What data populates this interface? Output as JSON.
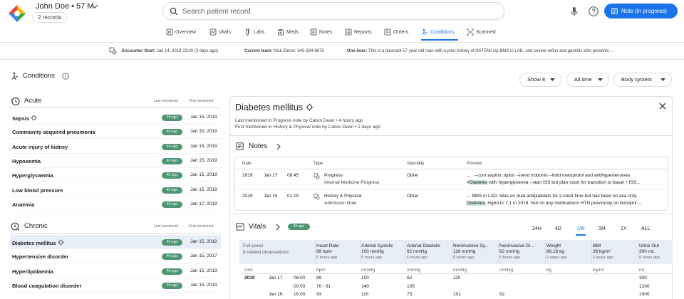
{
  "header": {
    "patient": "John Doe • 57 M",
    "records_chip": "2 records",
    "search_placeholder": "Search patient record",
    "note_button": "Note (in progress)",
    "colors": {
      "accent": "#1a73e8",
      "badge": "#4f9774"
    }
  },
  "tabs": [
    {
      "label": "Overview",
      "icon": "overview-icon"
    },
    {
      "label": "Vitals",
      "icon": "vitals-icon"
    },
    {
      "label": "Labs",
      "icon": "labs-icon"
    },
    {
      "label": "Meds",
      "icon": "meds-icon"
    },
    {
      "label": "Notes",
      "icon": "notes-icon"
    },
    {
      "label": "Reports",
      "icon": "reports-icon"
    },
    {
      "label": "Orders",
      "icon": "orders-icon"
    },
    {
      "label": "Conditions",
      "icon": "conditions-icon",
      "active": true
    },
    {
      "label": "Scanned",
      "icon": "scanned-icon"
    }
  ],
  "encounter": {
    "start_label": "Encounter Start:",
    "start_value": "Jan 14, 2019  23:00 (3 days ago)",
    "team_label": "Current team:",
    "team_value": "Nick Elmos: 645-334-9675",
    "oneliner_label": "One-liner:",
    "oneliner_value": "This is a pleasant 57 year-old man with a prior history of NSTEMI s/p BMS in LAD, and severe reflux and gastritis who presents ..."
  },
  "conditions": {
    "title": "Conditions",
    "filters": [
      "Show 8",
      "All time",
      "Body system"
    ],
    "acute": {
      "title": "Acute",
      "col_last": "Last mentioned",
      "col_first": "First mentioned",
      "items": [
        {
          "name": "Sepsis",
          "badge": "4h ago",
          "date": "Jan 15, 2019"
        },
        {
          "name": "Community acquired pneumonia",
          "badge": "4h ago",
          "date": "Jan 15, 2019"
        },
        {
          "name": "Acute injury of kidney",
          "badge": "4h ago",
          "date": "Jan 15, 2019"
        },
        {
          "name": "Hypoxemia",
          "badge": "4h ago",
          "date": "Jan 15, 2019"
        },
        {
          "name": "Hyperglycaemia",
          "badge": "4h ago",
          "date": "Jan 15, 2019"
        },
        {
          "name": "Low blood pressure",
          "badge": "4h ago",
          "date": "Jan 15, 2019"
        },
        {
          "name": "Anaemia",
          "badge": "4h ago",
          "date": "Jan 17, 2019"
        }
      ]
    },
    "chronic": {
      "title": "Chronic",
      "col_last": "Last mentioned",
      "col_first": "First mentioned",
      "items": [
        {
          "name": "Diabetes mellitus",
          "badge": "4h ago",
          "date": "Jan 15, 2019"
        },
        {
          "name": "Hypertensive disorder",
          "badge": "4h ago",
          "date": "Jan 15, 2017"
        },
        {
          "name": "Hyperlipidaemia",
          "badge": "4h ago",
          "date": "Jan 15, 2019"
        },
        {
          "name": "Blood coagulation disorder",
          "badge": "4h ago",
          "date": "Jan 15, 2019"
        }
      ]
    }
  },
  "detail": {
    "title": "Diabetes mellitus",
    "last_mentioned": "Last mentioned in Progress note by Calvin Dean • 4 hours ago",
    "first_mentioned": "First mentioned in History & Physical note by Calvin Dean • 2 days ago",
    "notes": {
      "title": "Notes",
      "columns": [
        "Date",
        "Type",
        "Specialty",
        "Preview"
      ],
      "rows": [
        {
          "year": "2019",
          "day": "Jan 17",
          "time": "08:45",
          "type": "Progress",
          "subtype": "Internal Medicine Progress",
          "specialty": "Other",
          "preview1": "... . --cont aspirin, lipitor --trend troponin --hold metoprolol and antihypertensives",
          "preview2_pre": "#",
          "preview2_hl": "Diabetes",
          "preview2_post": " with hyperglycemia --start ISS but plan soon for transition to basal + ISS..."
        },
        {
          "year": "2019",
          "day": "Jan 15",
          "time": "01:15",
          "type": "History & Physical",
          "subtype": "Admission Note",
          "specialty": "Other",
          "preview1": "... BMS in LAD. Was on dual antiplatelets for a short time but has been on asa only.",
          "preview2_pre": "",
          "preview2_hl": "Diabetes",
          "preview2_post": ", HgbA1c 7.1 in 2018. Not on any medications HTN previously on lisinopril ..."
        }
      ]
    },
    "vitals": {
      "title": "Vitals",
      "badge": "4h ago",
      "ranges": [
        "24H",
        "4D",
        "1W",
        "1M",
        "1Y",
        "ALL"
      ],
      "active_range": "1W",
      "full_panel": "Full panel",
      "related": "8 related observations",
      "unit_label": "Unit",
      "columns": [
        {
          "name": "Heart Rate",
          "value": "89 bpm",
          "ago": "5 hours ago",
          "unit": "bpm"
        },
        {
          "name": "Arterial Systolic",
          "value": "100 mmHg",
          "ago": "5 hours ago",
          "unit": "mmHg"
        },
        {
          "name": "Arterial Diastolic",
          "value": "62 mmHg",
          "ago": "5 hours ago",
          "unit": "mmHg"
        },
        {
          "name": "Noninvasive Sy...",
          "value": "110 mmHg",
          "ago": "5 hours ago",
          "unit": "mmHg"
        },
        {
          "name": "Noninvasive Di...",
          "value": "62 mmHg",
          "ago": "5 hours ago",
          "unit": "mmHg"
        },
        {
          "name": "Weight",
          "value": "86.18 kg",
          "ago": "2 years ago",
          "unit": "kg"
        },
        {
          "name": "BMI",
          "value": "28 kg/m²",
          "ago": "2 years ago",
          "unit": "kg/m²"
        },
        {
          "name": "Urine Out",
          "value": "300 mL",
          "ago": "5 hours ago",
          "unit": "mL"
        }
      ],
      "rows": [
        {
          "year": "2019",
          "date": "Jan 17",
          "time": "08:00",
          "values": [
            "89",
            "100",
            "62",
            "110",
            "",
            "",
            "",
            "300"
          ]
        },
        {
          "year": "",
          "date": "",
          "time": "00:00",
          "values": [
            "70 - 91",
            "140",
            "105",
            "",
            "",
            "",
            "",
            "1200"
          ]
        },
        {
          "year": "",
          "date": "Jan 16",
          "time": "16:00",
          "values": [
            "93",
            "110",
            "73",
            "101",
            "62",
            "",
            "",
            "1000"
          ]
        }
      ]
    }
  }
}
